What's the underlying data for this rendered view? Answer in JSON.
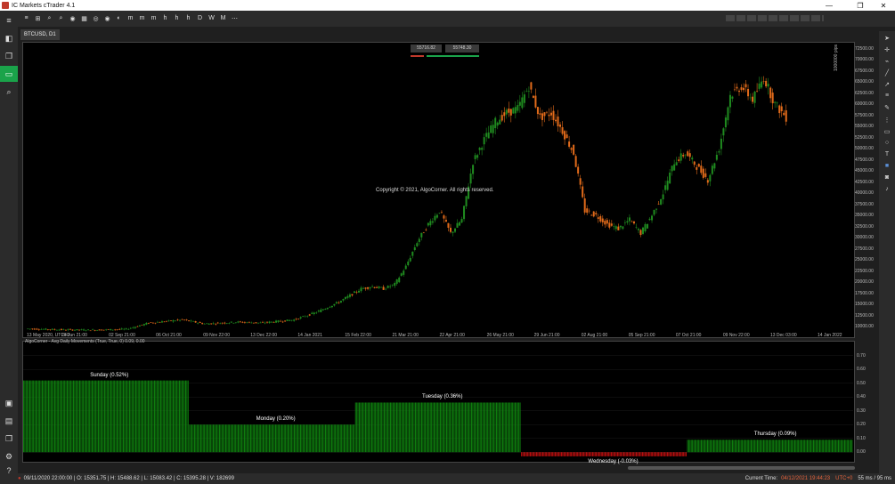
{
  "app": {
    "title": "IC Markets cTrader 4.1"
  },
  "window_controls": {
    "minimize": "—",
    "maximize": "❐",
    "close": "✕"
  },
  "toolbar": {
    "items": [
      "≡",
      "⊞",
      "⌕",
      "⌕",
      "◉",
      "▦",
      "◎",
      "◉",
      "◐",
      "m",
      "m",
      "m",
      "h",
      "h",
      "h",
      "D",
      "W",
      "M",
      "⋯"
    ]
  },
  "tab": {
    "label": "BTCUSD, D1"
  },
  "price_boxes": {
    "sell": "55716.82",
    "buy": "55748.30"
  },
  "watermark": "Copyright © 2021, AlgoCorner. All rights reserved.",
  "scale_label": "1000000 pips",
  "chart_data": [
    {
      "type": "candlestick",
      "symbol": "BTCUSD, D1",
      "y_ticks": [
        "72500.00",
        "70000.00",
        "67500.00",
        "65000.00",
        "62500.00",
        "60000.00",
        "57500.00",
        "55000.00",
        "52500.00",
        "50000.00",
        "47500.00",
        "45000.00",
        "42500.00",
        "40000.00",
        "37500.00",
        "35000.00",
        "32500.00",
        "30000.00",
        "27500.00",
        "25000.00",
        "22500.00",
        "20000.00",
        "17500.00",
        "15000.00",
        "12500.00",
        "10000.00"
      ],
      "x_ticks": [
        "13 May 2020, UTC+0",
        "28 Jun 21:00",
        "02 Sep 21:00",
        "06 Oct 21:00",
        "09 Nov 22:00",
        "13 Dec 22:00",
        "14 Jan 2021",
        "15 Feb 22:00",
        "21 Mar 21:00",
        "22 Apr 21:00",
        "26 May 21:00",
        "29 Jun 21:00",
        "02 Aug 21:00",
        "05 Sep 21:00",
        "07 Oct 21:00",
        "09 Nov 22:00",
        "13 Dec 03:00",
        "14 Jan 2022"
      ],
      "ylim": [
        9000,
        73000
      ],
      "colors": {
        "up": "#1f8a1f",
        "down": "#e06a1a"
      },
      "close_path": [
        [
          0,
          9500
        ],
        [
          15,
          9300
        ],
        [
          30,
          9200
        ],
        [
          45,
          9400
        ],
        [
          55,
          10800
        ],
        [
          70,
          11500
        ],
        [
          80,
          10600
        ],
        [
          95,
          11000
        ],
        [
          105,
          10800
        ],
        [
          120,
          11500
        ],
        [
          130,
          13200
        ],
        [
          140,
          15500
        ],
        [
          150,
          18500
        ],
        [
          155,
          19000
        ],
        [
          160,
          18500
        ],
        [
          165,
          19500
        ],
        [
          170,
          23500
        ],
        [
          175,
          29000
        ],
        [
          180,
          33000
        ],
        [
          185,
          36000
        ],
        [
          190,
          31000
        ],
        [
          195,
          34000
        ],
        [
          200,
          47000
        ],
        [
          205,
          52000
        ],
        [
          210,
          56000
        ],
        [
          215,
          58000
        ],
        [
          220,
          59000
        ],
        [
          225,
          64000
        ],
        [
          230,
          57000
        ],
        [
          235,
          58000
        ],
        [
          240,
          54000
        ],
        [
          245,
          49000
        ],
        [
          250,
          36000
        ],
        [
          255,
          35000
        ],
        [
          260,
          33000
        ],
        [
          265,
          32000
        ],
        [
          270,
          34000
        ],
        [
          275,
          31000
        ],
        [
          280,
          35000
        ],
        [
          285,
          40000
        ],
        [
          290,
          47000
        ],
        [
          295,
          49000
        ],
        [
          300,
          46000
        ],
        [
          305,
          43000
        ],
        [
          310,
          50000
        ],
        [
          315,
          62000
        ],
        [
          320,
          64000
        ],
        [
          325,
          61000
        ],
        [
          330,
          66000
        ],
        [
          335,
          60000
        ],
        [
          340,
          57000
        ]
      ]
    },
    {
      "type": "bar",
      "title": "AlgoCorner - Avg Daily Movements (True, True, 0) 0.09, 0.00",
      "categories": [
        "Sunday",
        "Monday",
        "Tuesday",
        "Wednesday",
        "Thursday"
      ],
      "labels": [
        "Sunday (0.52%)",
        "Monday (0.20%)",
        "Tuesday (0.36%)",
        "Wednesday (-0.03%)",
        "Thursday (0.09%)"
      ],
      "values": [
        0.52,
        0.2,
        0.36,
        -0.03,
        0.09
      ],
      "y_ticks": [
        "0.70",
        "0.60",
        "0.50",
        "0.40",
        "0.30",
        "0.20",
        "0.10",
        "0.00"
      ],
      "ylim": [
        -0.05,
        0.75
      ],
      "colors": {
        "positive": "#0f8a0f",
        "negative": "#cc1010"
      }
    }
  ],
  "status": {
    "ohlc": "09/11/2020 22:00:00 | O: 15351.75 | H: 15488.62 | L: 15083.42 | C: 15395.28 | V: 182699",
    "time_label": "Current Time:",
    "time_value": "04/12/2021 19:44:23",
    "tz": "UTC+0",
    "latency": "55 ms / 95 ms"
  },
  "colors": {
    "accent": "#1aa34a",
    "background": "#000000",
    "chrome": "#2b2b2b"
  }
}
